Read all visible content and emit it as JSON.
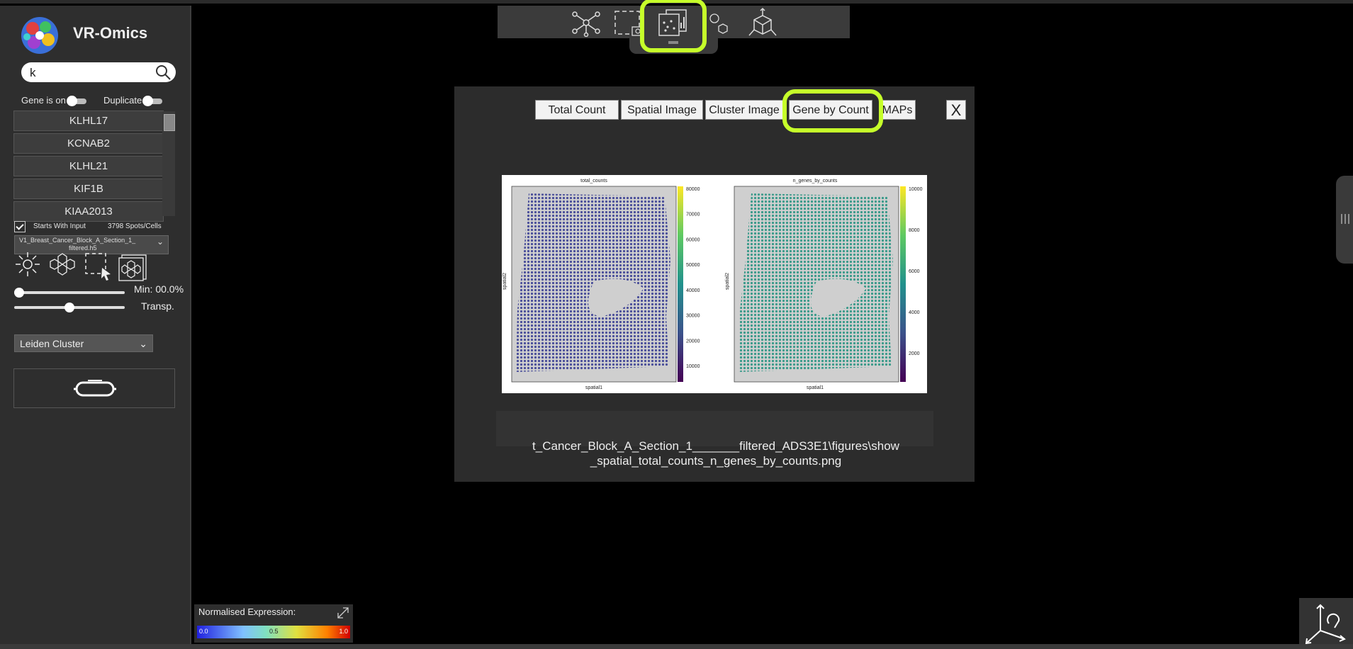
{
  "app": {
    "title": "VR-Omics"
  },
  "search": {
    "value": "k"
  },
  "toggles": {
    "gene_is_on": "Gene is on",
    "duplicate": "Duplicate"
  },
  "genes": [
    "KLHL17",
    "KCNAB2",
    "KLHL21",
    "KIF1B",
    "KIAA2013"
  ],
  "filter": {
    "starts_with_input": "Starts With Input",
    "spots_count": "3798 Spots/Cells"
  },
  "dataset": {
    "line1": "V1_Breast_Cancer_Block_A_Section_1_",
    "line2": "filtered.h5"
  },
  "sliders": {
    "min_label": "Min: 00.0%",
    "transp_label": "Transp.",
    "min_value": 0.0,
    "transp_value": 0.5
  },
  "cluster_dropdown": {
    "selected": "Leiden Cluster"
  },
  "modal": {
    "tabs": [
      "Total Count",
      "Spatial Image",
      "Cluster Image",
      "Gene by Count",
      "MAPs"
    ],
    "active_tab": "Gene by Count",
    "close_label": "X",
    "path_line1": "t_Cancer_Block_A_Section_1_______filtered_ADS3E1\\figures\\show",
    "path_line2": "_spatial_total_counts_n_genes_by_counts.png"
  },
  "figure": {
    "left": {
      "title": "total_counts",
      "ylabel": "spatial2",
      "xlabel": "spatial1",
      "ticks": [
        "80000",
        "70000",
        "60000",
        "50000",
        "40000",
        "30000",
        "20000",
        "10000"
      ]
    },
    "right": {
      "title": "n_genes_by_counts",
      "ylabel": "spatial2",
      "xlabel": "spatial1",
      "ticks": [
        "10000",
        "8000",
        "6000",
        "4000",
        "2000"
      ]
    }
  },
  "legend": {
    "title": "Normalised Expression:",
    "min": "0.0",
    "mid": "0.5",
    "max": "1.0"
  },
  "colors": {
    "highlight": "#c6ff2a",
    "sidebar": "#2e2e2e",
    "modal": "#2c2c2c"
  }
}
